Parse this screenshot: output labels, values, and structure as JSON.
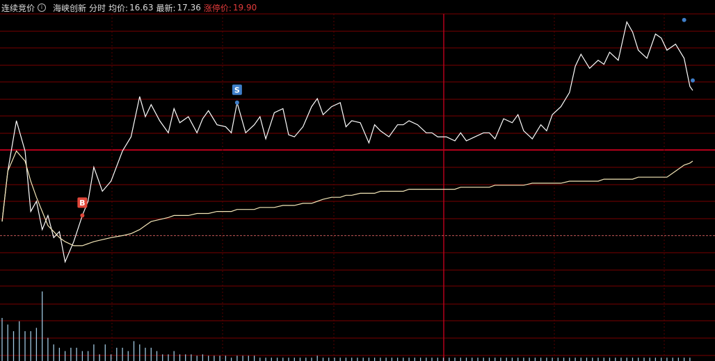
{
  "header": {
    "auction_label": "连续竞价",
    "stock_name": "海峡创新",
    "view_label": "分时",
    "avg_label": "均价:",
    "avg_value": "16.63",
    "latest_label": "最新:",
    "latest_value": "17.36",
    "limit_label": "涨停价:",
    "limit_value": "19.90"
  },
  "colors": {
    "background": "#000000",
    "grid": "#7a0000",
    "grid_major": "#b3001a",
    "price_line": "#ffffff",
    "avg_line": "#f5e7b8",
    "prev_close_line": "#c85a5a",
    "buy_marker": "#e0473a",
    "sell_marker": "#3f7ec9",
    "volume_bar": "#9fc7e0"
  },
  "chart_data": [
    {
      "type": "line",
      "x": [
        0,
        2,
        5,
        8,
        10,
        12,
        14,
        16,
        18,
        20,
        22,
        25,
        28,
        30,
        32,
        35,
        38,
        42,
        45,
        48,
        50,
        52,
        55,
        58,
        60,
        62,
        65,
        68,
        70,
        72,
        75,
        78,
        80,
        82,
        85,
        88,
        90,
        92,
        95,
        98,
        100,
        102,
        105,
        108,
        110,
        112,
        115,
        118,
        120,
        122,
        125,
        128,
        130,
        132,
        135,
        138,
        140,
        142,
        145,
        148,
        150,
        152,
        155,
        158,
        160,
        162,
        165,
        168,
        170,
        172,
        175,
        178,
        180,
        182,
        185,
        188,
        190,
        192,
        195,
        198,
        200,
        202,
        205,
        208,
        210,
        212,
        215,
        218,
        220,
        222,
        225,
        228,
        230,
        232,
        235,
        238,
        240,
        241
      ],
      "series": [
        {
          "values": [
            16.7,
            16.95,
            17.2,
            17.05,
            16.75,
            16.8,
            16.66,
            16.73,
            16.62,
            16.65,
            16.5,
            16.6,
            16.73,
            16.8,
            16.97,
            16.85,
            16.9,
            17.05,
            17.12,
            17.32,
            17.22,
            17.28,
            17.2,
            17.14,
            17.26,
            17.19,
            17.22,
            17.14,
            17.21,
            17.25,
            17.18,
            17.17,
            17.14,
            17.29,
            17.14,
            17.18,
            17.22,
            17.11,
            17.24,
            17.26,
            17.13,
            17.12,
            17.17,
            17.27,
            17.31,
            17.23,
            17.27,
            17.29,
            17.17,
            17.2,
            17.19,
            17.09,
            17.18,
            17.15,
            17.12,
            17.18,
            17.18,
            17.2,
            17.18,
            17.14,
            17.14,
            17.12,
            17.12,
            17.1,
            17.14,
            17.1,
            17.12,
            17.14,
            17.14,
            17.11,
            17.21,
            17.19,
            17.23,
            17.15,
            17.11,
            17.18,
            17.15,
            17.23,
            17.27,
            17.34,
            17.47,
            17.53,
            17.46,
            17.5,
            17.48,
            17.54,
            17.5,
            17.69,
            17.64,
            17.55,
            17.51,
            17.63,
            17.61,
            17.55,
            17.58,
            17.51,
            17.37,
            17.35
          ],
          "color": "#ffffff"
        },
        {
          "values": [
            16.7,
            16.95,
            17.05,
            17.0,
            16.9,
            16.82,
            16.75,
            16.68,
            16.65,
            16.62,
            16.6,
            16.58,
            16.58,
            16.59,
            16.6,
            16.61,
            16.62,
            16.63,
            16.64,
            16.66,
            16.68,
            16.7,
            16.71,
            16.72,
            16.73,
            16.73,
            16.73,
            16.74,
            16.74,
            16.74,
            16.75,
            16.75,
            16.75,
            16.76,
            16.76,
            16.76,
            16.77,
            16.77,
            16.77,
            16.78,
            16.78,
            16.78,
            16.79,
            16.79,
            16.8,
            16.81,
            16.82,
            16.82,
            16.83,
            16.83,
            16.84,
            16.84,
            16.84,
            16.85,
            16.85,
            16.85,
            16.85,
            16.86,
            16.86,
            16.86,
            16.86,
            16.86,
            16.86,
            16.86,
            16.87,
            16.87,
            16.87,
            16.87,
            16.87,
            16.88,
            16.88,
            16.88,
            16.88,
            16.88,
            16.89,
            16.89,
            16.89,
            16.89,
            16.89,
            16.9,
            16.9,
            16.9,
            16.9,
            16.9,
            16.91,
            16.91,
            16.91,
            16.91,
            16.91,
            16.92,
            16.92,
            16.92,
            16.92,
            16.92,
            16.95,
            16.98,
            16.99,
            17.0
          ],
          "color": "#f5e7b8"
        }
      ],
      "markers": [
        {
          "label": "B",
          "x": 28,
          "y": 16.73,
          "kind": "buy"
        },
        {
          "label": "S",
          "x": 82,
          "y": 17.29,
          "kind": "sell"
        }
      ],
      "end_points": [
        {
          "x": 238,
          "y": 17.7
        },
        {
          "x": 241,
          "y": 17.4
        }
      ],
      "reference_line": 16.63,
      "ylim": [
        16.38,
        17.73
      ],
      "xlim": [
        0,
        241
      ]
    },
    {
      "type": "bar",
      "x": [
        0,
        2,
        4,
        6,
        8,
        10,
        12,
        14,
        16,
        18,
        20,
        22,
        24,
        26,
        28,
        30,
        32,
        34,
        36,
        38,
        40,
        42,
        44,
        46,
        48,
        50,
        52,
        54,
        56,
        58,
        60,
        62,
        64,
        66,
        68,
        70,
        72,
        74,
        76,
        78,
        80,
        82,
        84,
        86,
        88,
        90,
        92,
        94,
        96,
        98,
        100,
        102,
        104,
        106,
        108,
        110,
        112,
        114,
        116,
        118,
        120,
        122,
        124,
        126,
        128,
        130,
        132,
        134,
        136,
        138,
        140,
        142,
        144,
        146,
        148,
        150,
        152,
        154,
        156,
        158,
        160,
        162,
        164,
        166,
        168,
        170,
        172,
        174,
        176,
        178,
        180,
        182,
        184,
        186,
        188,
        190,
        192,
        194,
        196,
        198,
        200,
        202,
        204,
        206,
        208,
        210,
        212,
        214,
        216,
        218,
        220,
        222,
        224,
        226,
        228,
        230,
        232,
        234,
        236,
        238,
        240
      ],
      "values": [
        65,
        55,
        45,
        60,
        45,
        45,
        50,
        105,
        35,
        25,
        20,
        15,
        20,
        20,
        15,
        15,
        25,
        10,
        25,
        10,
        20,
        20,
        15,
        30,
        25,
        20,
        20,
        15,
        10,
        10,
        15,
        10,
        10,
        10,
        8,
        10,
        8,
        8,
        8,
        8,
        5,
        8,
        8,
        8,
        8,
        5,
        5,
        5,
        5,
        5,
        5,
        5,
        5,
        5,
        5,
        8,
        5,
        5,
        5,
        5,
        5,
        5,
        5,
        5,
        5,
        5,
        5,
        5,
        5,
        5,
        5,
        5,
        5,
        5,
        5,
        5,
        5,
        5,
        5,
        5,
        5,
        5,
        5,
        5,
        5,
        5,
        5,
        5,
        5,
        5,
        5,
        5,
        5,
        5,
        5,
        5,
        5,
        5,
        5,
        5,
        5,
        5,
        5,
        5,
        5,
        5,
        5,
        5,
        5,
        5,
        5,
        5,
        5,
        5,
        5,
        5,
        5,
        5,
        5,
        5,
        5
      ],
      "ylim": [
        0,
        110
      ],
      "color": "#9fc7e0"
    }
  ]
}
